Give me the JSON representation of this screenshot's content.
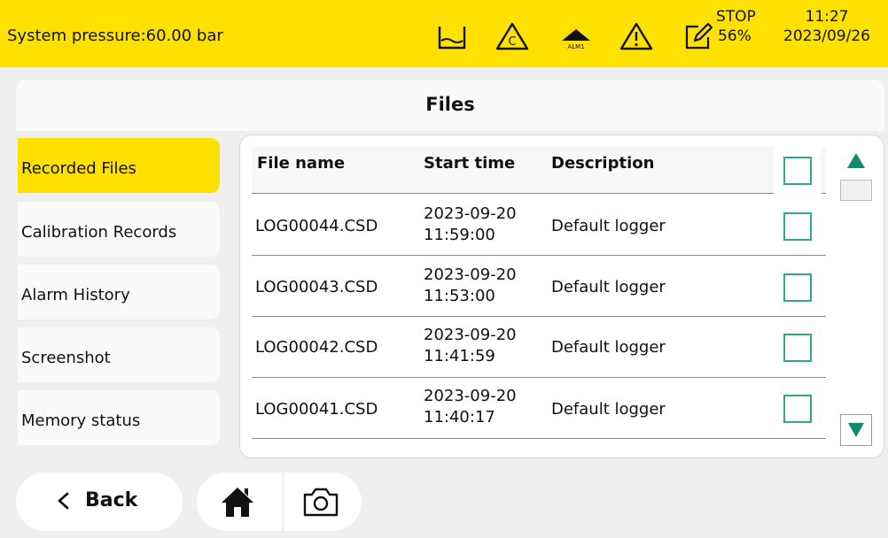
{
  "status_bar": {
    "pressure_label": "System pressure:60.00 bar",
    "alarm_icon_label": "ALM1",
    "calibration_icon_label": "C",
    "stop_label": "STOP",
    "stop_percent": "56%",
    "time": "11:27",
    "date": "2023/09/26",
    "colors": {
      "bar": "#ffe100"
    },
    "icons": [
      "tank-icon",
      "calibration-icon",
      "alarm-mountain-icon",
      "warning-icon",
      "edit-icon"
    ]
  },
  "page": {
    "title": "Files"
  },
  "sidebar": {
    "items": [
      {
        "label": "Recorded Files",
        "active": true
      },
      {
        "label": "Calibration Records",
        "active": false
      },
      {
        "label": "Alarm History",
        "active": false
      },
      {
        "label": "Screenshot",
        "active": false
      },
      {
        "label": "Memory status",
        "active": false
      }
    ]
  },
  "table": {
    "columns": [
      "File name",
      "Start time",
      "Description"
    ],
    "rows": [
      {
        "file": "LOG00044.CSD",
        "date": "2023-09-20",
        "time": "11:59:00",
        "description": "Default logger"
      },
      {
        "file": "LOG00043.CSD",
        "date": "2023-09-20",
        "time": "11:53:00",
        "description": "Default logger"
      },
      {
        "file": "LOG00042.CSD",
        "date": "2023-09-20",
        "time": "11:41:59",
        "description": "Default logger"
      },
      {
        "file": "LOG00041.CSD",
        "date": "2023-09-20",
        "time": "11:40:17",
        "description": "Default logger"
      }
    ],
    "checkbox_color": "#2ea98f"
  },
  "scroll": {
    "up_icon": "triangle-up-icon",
    "down_icon": "triangle-down-icon",
    "arrow_color": "#0f8a6e"
  },
  "bottom_nav": {
    "back_label": "Back",
    "icons": [
      "chevron-left-icon",
      "home-icon",
      "camera-icon"
    ]
  }
}
